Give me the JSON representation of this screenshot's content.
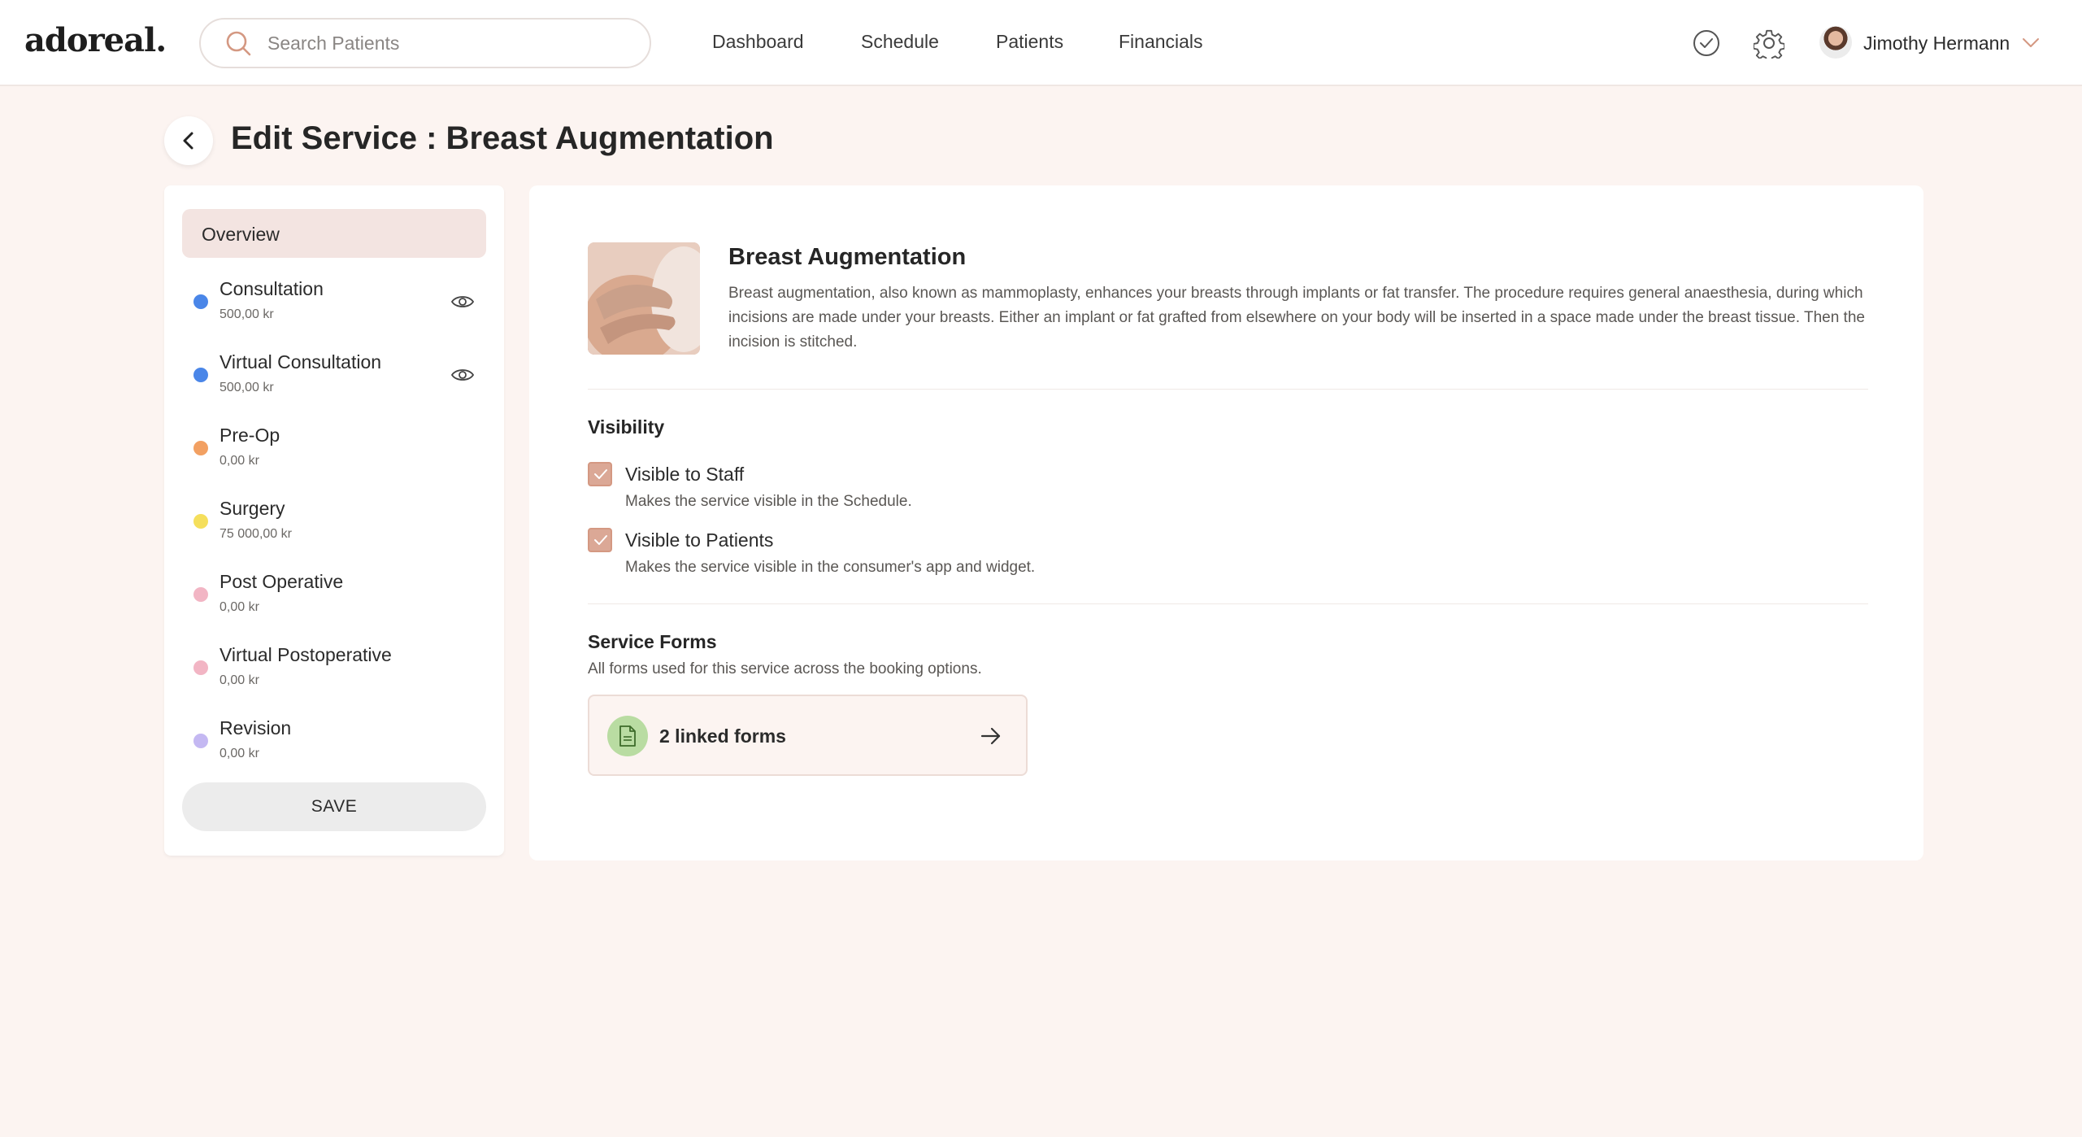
{
  "app": {
    "logo": "adoreal."
  },
  "search": {
    "placeholder": "Search Patients"
  },
  "nav": {
    "items": [
      {
        "label": "Dashboard"
      },
      {
        "label": "Schedule"
      },
      {
        "label": "Patients"
      },
      {
        "label": "Financials"
      }
    ]
  },
  "topbar_icons": [
    "check-circle-icon",
    "gear-icon"
  ],
  "user": {
    "name": "Jimothy Hermann"
  },
  "page": {
    "title": "Edit Service : Breast Augmentation"
  },
  "sidebar": {
    "overview_label": "Overview",
    "services": [
      {
        "name": "Consultation",
        "price": "500,00 kr",
        "color": "#4a86e8",
        "visible_icon": true
      },
      {
        "name": "Virtual Consultation",
        "price": "500,00 kr",
        "color": "#4a86e8",
        "visible_icon": true
      },
      {
        "name": "Pre-Op",
        "price": "0,00 kr",
        "color": "#f2a062",
        "visible_icon": false
      },
      {
        "name": "Surgery",
        "price": "75 000,00 kr",
        "color": "#f5df5c",
        "visible_icon": false
      },
      {
        "name": "Post Operative",
        "price": "0,00 kr",
        "color": "#f2b5c4",
        "visible_icon": false
      },
      {
        "name": "Virtual Postoperative",
        "price": "0,00 kr",
        "color": "#f2b5c4",
        "visible_icon": false
      },
      {
        "name": "Revision",
        "price": "0,00 kr",
        "color": "#c4b8f2",
        "visible_icon": false
      }
    ],
    "save_label": "SAVE"
  },
  "service": {
    "title": "Breast Augmentation",
    "description": "Breast augmentation, also known as mammoplasty, enhances your breasts through implants or fat transfer. The procedure requires general anaesthesia, during which incisions are made under your breasts. Either an implant or fat grafted from elsewhere on your body will be inserted in a space made under the breast tissue. Then the incision is stitched."
  },
  "visibility": {
    "title": "Visibility",
    "options": [
      {
        "label": "Visible to Staff",
        "help": "Makes the service visible in the Schedule.",
        "checked": true
      },
      {
        "label": "Visible to Patients",
        "help": "Makes the service visible in the consumer's app and widget.",
        "checked": true
      }
    ]
  },
  "forms": {
    "title": "Service Forms",
    "subtitle": "All forms used for this service across the booking options.",
    "linked_label": "2 linked forms"
  },
  "colors": {
    "accent": "#dba896",
    "background": "#fcf4f1",
    "overview_active": "#f3e4e1",
    "forms_icon_bg": "#b9dca2"
  }
}
